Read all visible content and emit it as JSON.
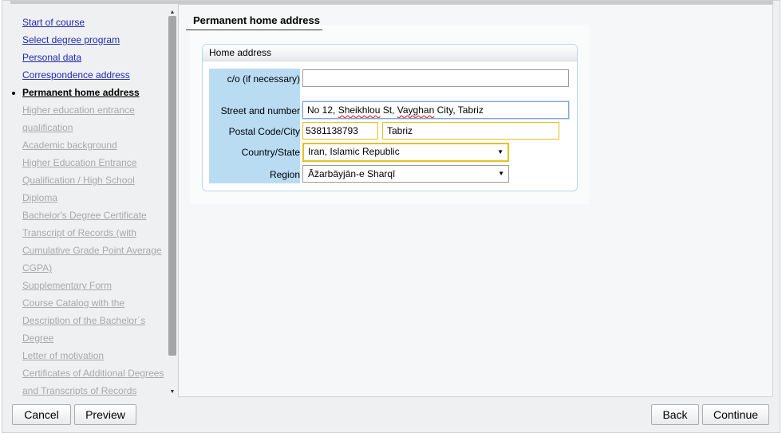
{
  "sidebar": {
    "items": [
      {
        "label": "Start of course",
        "state": "link"
      },
      {
        "label": "Select degree program",
        "state": "link"
      },
      {
        "label": "Personal data",
        "state": "link"
      },
      {
        "label": "Correspondence address",
        "state": "link"
      },
      {
        "label": "Permanent home address",
        "state": "current"
      },
      {
        "label": "Higher education entrance",
        "state": "disabled"
      },
      {
        "label": "qualification",
        "state": "disabled"
      },
      {
        "label": "Academic background",
        "state": "disabled"
      },
      {
        "label": "Higher Education Entrance",
        "state": "disabled"
      },
      {
        "label": "Qualification / High School",
        "state": "disabled"
      },
      {
        "label": "Diploma",
        "state": "disabled"
      },
      {
        "label": "Bachelor's Degree Certificate",
        "state": "disabled"
      },
      {
        "label": "Transcript of Records (with",
        "state": "disabled"
      },
      {
        "label": "Cumulative Grade Point Average",
        "state": "disabled"
      },
      {
        "label": "CGPA)",
        "state": "disabled"
      },
      {
        "label": "Supplementary Form",
        "state": "disabled"
      },
      {
        "label": "Course Catalog with the",
        "state": "disabled"
      },
      {
        "label": "Description of the Bachelor´s",
        "state": "disabled"
      },
      {
        "label": "Degree",
        "state": "disabled"
      },
      {
        "label": "Letter of motivation",
        "state": "disabled"
      },
      {
        "label": "Certificates of Additional Degrees",
        "state": "disabled"
      },
      {
        "label": "and Transcripts of Records",
        "state": "disabled"
      }
    ]
  },
  "main": {
    "section_title": "Permanent home address",
    "fieldset_title": "Home address",
    "fields": {
      "co_label": "c/o (if necessary)",
      "co_value": "",
      "street_label": "Street and number",
      "street_value_parts": [
        "No 12, ",
        "Sheikhlou",
        " St, ",
        "Vayghan",
        " City, Tabriz"
      ],
      "postal_label": "Postal Code/City",
      "postal_value": "5381138793",
      "city_value": "Tabriz",
      "country_label": "Country/State",
      "country_value": "Iran, Islamic Republic",
      "region_label": "Region",
      "region_value": "Āžarbāyjān-e Sharqī"
    }
  },
  "buttons": {
    "cancel": "Cancel",
    "preview": "Preview",
    "back": "Back",
    "continue": "Continue"
  },
  "icons": {
    "scroll_up": "▲",
    "scroll_down": "▼",
    "dropdown": "▼"
  },
  "colors": {
    "link": "#1f2bb4",
    "disabled": "#a7a9ab",
    "label_column": "#b9dcf3",
    "warning_border": "#e6c021"
  }
}
